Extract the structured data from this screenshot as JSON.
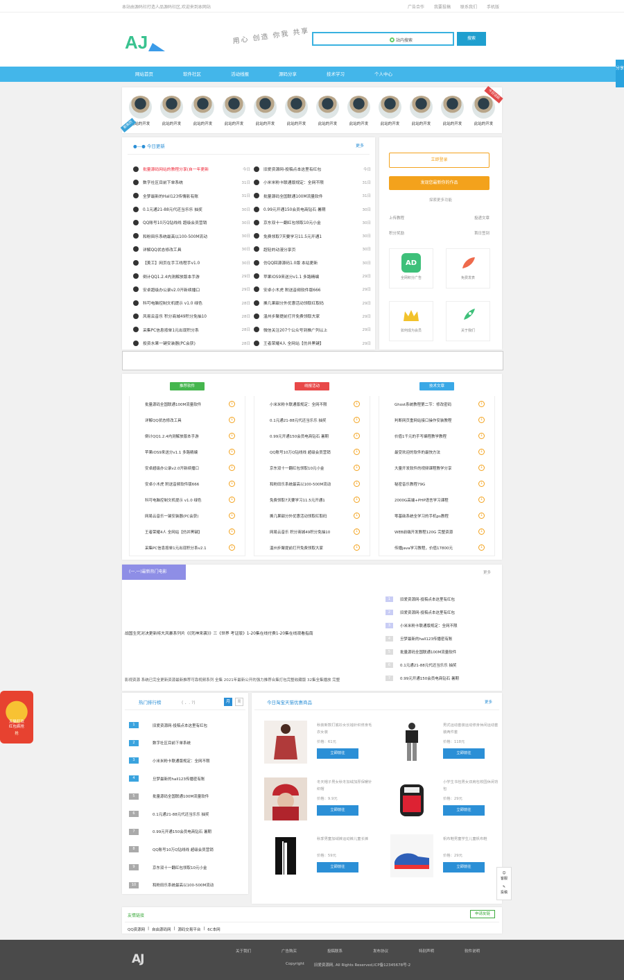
{
  "topbar": {
    "welcome": "本站由源码社打造人品源码社区,欢迎来到本网站",
    "links": [
      "广告合作",
      "我要投稿",
      "联系我们",
      "手机版"
    ]
  },
  "header": {
    "logo_text": "AJ",
    "slogan": "用心 创造 你我 共享",
    "search_placeholder": "站内搜索",
    "search_button": "搜索"
  },
  "nav": {
    "items": [
      "网站首页",
      "软件社区",
      "活动线报",
      "源码分享",
      "技术学习",
      "个人中心"
    ]
  },
  "share_label": "分享",
  "avatars": {
    "name": "此站的开发",
    "count": 12,
    "ribbon_left": "新来的",
    "ribbon_right": "今日活跃"
  },
  "today": {
    "title": "今日更新",
    "more": "更多",
    "left": [
      {
        "t": "批量源码网站的教程分享(自一年更新",
        "d": "今日",
        "red": true
      },
      {
        "t": "数字社区目前下单系统",
        "d": "31日"
      },
      {
        "t": "全梦最新的Hall123传情影有账",
        "d": "31日"
      },
      {
        "t": "0.1元通21-88元代还当乐乐 抽奖",
        "d": "30日"
      },
      {
        "t": "QQ账号10万Q钻线线 超级会员营销",
        "d": "30日"
      },
      {
        "t": "和粉田乐系统最高以100-500M流动",
        "d": "30日"
      },
      {
        "t": "详解QQ状态修改工具",
        "d": "30日"
      },
      {
        "t": "【美工】网页在手工线程手v1.0",
        "d": "30日"
      },
      {
        "t": "倒计QQ1.2.4内测解放版本手游",
        "d": "29日"
      },
      {
        "t": "安卓超级办公录v2.0开新续播口",
        "d": "29日"
      },
      {
        "t": "科可电脑控制文机提示 v1.0 绿色",
        "d": "28日"
      },
      {
        "t": "风易云音乐 积分商城49积分免抽10",
        "d": "28日"
      },
      {
        "t": "采集PC信息按单1元出现积分系",
        "d": "28日"
      },
      {
        "t": "投资水果一键安装器(PC会获)",
        "d": "28日"
      }
    ],
    "right": [
      {
        "t": "旧爱资源网-投稿点本这里有红包",
        "d": "今日"
      },
      {
        "t": "小米米粉卡联通版规定：全网不限",
        "d": "31日"
      },
      {
        "t": "批量源码全国联通100M流量软件",
        "d": "31日"
      },
      {
        "t": "0.99元开通150会员电商钻石 暑期",
        "d": "30日"
      },
      {
        "t": "京东双十一翻红包领取10元小金",
        "d": "30日"
      },
      {
        "t": "免费领取7天要学习11.5元开通1",
        "d": "30日"
      },
      {
        "t": "超轻的动漫分享页",
        "d": "30日"
      },
      {
        "t": "仿QQ回源源码1.0版 本站更新",
        "d": "30日"
      },
      {
        "t": "苹果iOS9来送分v1.1 多路精编",
        "d": "29日"
      },
      {
        "t": "安卓小木虎 附送音频软件版666",
        "d": "29日"
      },
      {
        "t": "撕几果甜分外优惠活动领取红取码",
        "d": "29日"
      },
      {
        "t": "温州步聚提前打开免费领取大家",
        "d": "29日"
      },
      {
        "t": "微信关注207个公众号到推广列以上",
        "d": "29日"
      },
      {
        "t": "王者荣耀4人 全网站【仿并黑键】",
        "d": "29日"
      }
    ]
  },
  "user": {
    "login": "立即登录",
    "publish": "发现您最新你的作品",
    "label": "探索更多功能",
    "links": [
      "上传教程",
      "投递文章",
      "积分奖励",
      "首日签到"
    ],
    "tiles": [
      "全网积分广告",
      "免费发表",
      "如何成为会员",
      "关于我们"
    ]
  },
  "cats": [
    {
      "label": "推荐软件",
      "color": "#45b64e",
      "items": [
        "批量源码全国联通100M流量软件",
        "详解QQ状态修改工具",
        "倒计QQ1.2.4内测解放版本手游",
        "苹果iOS9来送分v1.1 多路精编",
        "安卓超级办公录v2.0开新续播口",
        "安卓小木虎 附送音频软件版666",
        "科可电脑控制文机提示 v1.0 绿色",
        "网易云音乐一键安装器(PC会获)",
        "王者荣耀4人 全网站【仿并黑键】",
        "采集PC信息按单1元出现积分系v2.1"
      ]
    },
    {
      "label": "线报活动",
      "color": "#e84848",
      "items": [
        "小米米粉卡联通版规定：全网不限",
        "0.1元通21-88元代还当乐乐 抽奖",
        "0.99元开通150会员电商钻石 暑期",
        "QQ账号10万Q钻线线 超级会员营销",
        "京东双十一翻红包领取10元小金",
        "和粉田乐系统最高以100-500M流动",
        "免费领取7天要学习11.5元开通1",
        "撕几果甜分外优惠活动领取红取码",
        "网易云音乐 积分商城49积分免抽10",
        "温州步聚提前打开免费领取大家"
      ]
    },
    {
      "label": "技术文章",
      "color": "#3aa8e6",
      "items": [
        "Ghost系统教程第二节：修改密码",
        "判断网页重网站接口操作安装教程",
        "价值1千元的手写编程教学教程",
        "最受欢迎的软件的最快方法",
        "大量开发软件的视频课程教学分享",
        "秘密音乐教程79G",
        "2000G高端+PHP语言学习课程",
        "零基础系统全学习的手机ps教程",
        "WEB前端开发教程120G 完整资源",
        "传播java学习教程，价值17800元"
      ]
    }
  ],
  "movie": {
    "tab": "(一.一)最新热门电影",
    "more": "更多",
    "p1": "战国生死对决更新将大风暴系列片《《死神来袭》》三《世界 考证版》1-20集在线付费1-20集在线观看指南",
    "p2": "影视资源 系统已完全更新资源最新推荐可靠视频系列 全集 2021年最新公开的强力推荐合集打包完整收藏版 32集全集播放 完整",
    "ranks": [
      "旧爱资源网-投稿点本这里有红包",
      "旧爱资源网-投稿点本这里有红包",
      "小米米粉卡联通版规定：全网不限",
      "旦梦最新的hall123传播密有账",
      "批量源码全国联通100M流量软件",
      "0.1元通21-88元代还当乐乐 抽奖",
      "0.99元开通150会员电商钻石 暑期"
    ]
  },
  "hot": {
    "title": "热门排行榜",
    "mark": "( ．. ?)",
    "tab1": "月",
    "tab2": "周",
    "items": [
      "旧爱资源网-投稿点本这里有红包",
      "数字社区目前下单系统",
      "小米米粉卡联通版规定：全网不限",
      "旦梦最新的hall123传播密有账",
      "批量源码全国联通100M流量软件",
      "0.1元通21-88元代还当乐乐 抽奖",
      "0.99元开通150会员电商钻石 暑期",
      "QQ账号10万Q钻线线 超级会员营销",
      "京东双十一翻红包领取10元小金",
      "和粉田乐系统最高以100-500M流动"
    ]
  },
  "tmall": {
    "title": "今日淘宝天猫优惠商品",
    "more": "更多",
    "products": [
      {
        "t": "秋装新款打底衫女长袖针织修身毛衣女装",
        "p": "价格：61元",
        "b": "立即前往"
      },
      {
        "t": "男式运动套装运动修身休闲运动套装两件套",
        "p": "价格：118元",
        "b": "立即前往"
      },
      {
        "t": "冬天帽子男女秋冬加绒加厚保暖针织帽",
        "p": "价格：9.9元",
        "b": "立即前往"
      },
      {
        "t": "小学生书包男女双肩包校园休闲背包",
        "p": "价格：29元",
        "b": "立即前往"
      },
      {
        "t": "秋季男童加绒裤运动裤儿童长裤",
        "p": "价格：59元",
        "b": "立即前往"
      },
      {
        "t": "帆布鞋男童学生儿童帆布鞋",
        "p": "价格：29元",
        "b": "立即前往"
      }
    ]
  },
  "float": {
    "a": "客服",
    "b": "投稿"
  },
  "redpack": {
    "line1": "天猫狂欢",
    "line2": "红包疯抢",
    "line3": "抢"
  },
  "friends": {
    "title": "友情链接",
    "apply": "申请友链",
    "links": [
      "QQ资源网",
      "|",
      "自由源码网",
      "|",
      "源码交易平台",
      "|",
      "6C本网"
    ]
  },
  "footer": {
    "logo": "AJ",
    "links": [
      "关于我们",
      "广告购买",
      "投稿联系",
      "发布协议",
      "特别声明",
      "软件说明"
    ],
    "copyright": "Copyright",
    "icp": "旧爱资源网, All Rights Reserved,ICP备12345678号-2"
  }
}
